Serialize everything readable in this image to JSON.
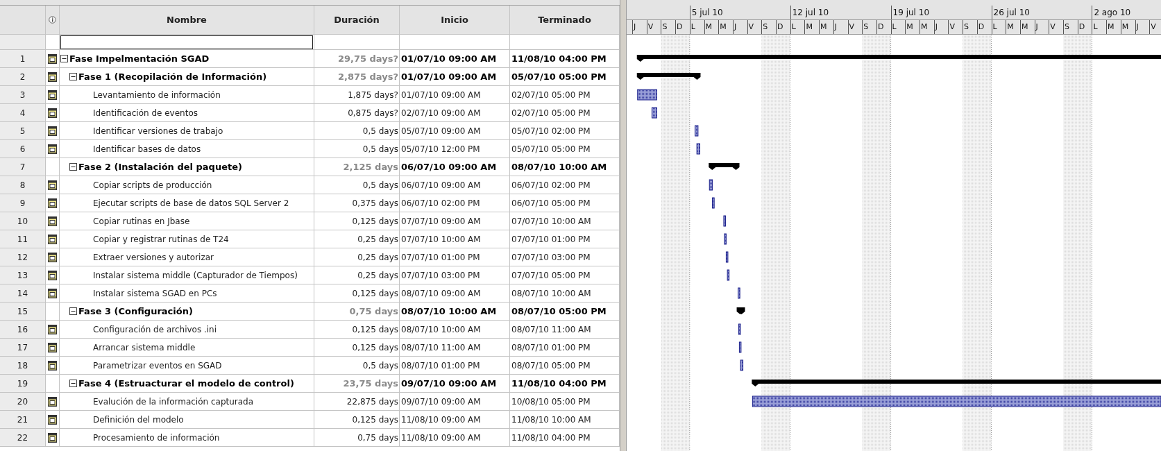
{
  "table": {
    "columns": [
      "Nombre",
      "Duración",
      "Inicio",
      "Terminado"
    ],
    "tasks": [
      {
        "id": "1",
        "kind": "summary",
        "name": "Fase Impelmentación SGAD",
        "duration": "29,75 days?",
        "start": "01/07/10 09:00 AM",
        "finish": "11/08/10 04:00 PM",
        "indicator": true,
        "expanded": true,
        "children": [
          {
            "id": "2",
            "kind": "summary",
            "name": "Fase 1 (Recopilación de Información)",
            "duration": "2,875 days?",
            "start": "01/07/10 09:00 AM",
            "finish": "05/07/10 05:00 PM",
            "indicator": true,
            "expanded": true,
            "children": [
              {
                "id": "3",
                "kind": "task",
                "name": "Levantamiento de información",
                "duration": "1,875 days?",
                "start": "01/07/10 09:00 AM",
                "finish": "02/07/10 05:00 PM",
                "indicator": true
              },
              {
                "id": "4",
                "kind": "task",
                "name": "Identificación de eventos",
                "duration": "0,875 days?",
                "start": "02/07/10 09:00 AM",
                "finish": "02/07/10 05:00 PM",
                "indicator": true
              },
              {
                "id": "5",
                "kind": "task",
                "name": "Identificar versiones de trabajo",
                "duration": "0,5 days",
                "start": "05/07/10 09:00 AM",
                "finish": "05/07/10 02:00 PM",
                "indicator": true
              },
              {
                "id": "6",
                "kind": "task",
                "name": "Identificar bases de datos",
                "duration": "0,5 days",
                "start": "05/07/10 12:00 PM",
                "finish": "05/07/10 05:00 PM",
                "indicator": true
              }
            ]
          },
          {
            "id": "7",
            "kind": "summary",
            "name": "Fase 2 (Instalación del paquete)",
            "duration": "2,125 days",
            "start": "06/07/10 09:00 AM",
            "finish": "08/07/10 10:00 AM",
            "indicator": false,
            "expanded": true,
            "children": [
              {
                "id": "8",
                "kind": "task",
                "name": "Copiar scripts de producción",
                "duration": "0,5 days",
                "start": "06/07/10 09:00 AM",
                "finish": "06/07/10 02:00 PM",
                "indicator": true
              },
              {
                "id": "9",
                "kind": "task",
                "name": "Ejecutar scripts de base de datos SQL Server 2",
                "duration": "0,375 days",
                "start": "06/07/10 02:00 PM",
                "finish": "06/07/10 05:00 PM",
                "indicator": true
              },
              {
                "id": "10",
                "kind": "task",
                "name": "Copiar rutinas en Jbase",
                "duration": "0,125 days",
                "start": "07/07/10 09:00 AM",
                "finish": "07/07/10 10:00 AM",
                "indicator": true
              },
              {
                "id": "11",
                "kind": "task",
                "name": "Copiar y registrar rutinas de T24",
                "duration": "0,25 days",
                "start": "07/07/10 10:00 AM",
                "finish": "07/07/10 01:00 PM",
                "indicator": true
              },
              {
                "id": "12",
                "kind": "task",
                "name": "Extraer versiones y autorizar",
                "duration": "0,25 days",
                "start": "07/07/10 01:00 PM",
                "finish": "07/07/10 03:00 PM",
                "indicator": true
              },
              {
                "id": "13",
                "kind": "task",
                "name": "Instalar sistema middle (Capturador de Tiempos)",
                "duration": "0,25 days",
                "start": "07/07/10 03:00 PM",
                "finish": "07/07/10 05:00 PM",
                "indicator": true
              },
              {
                "id": "14",
                "kind": "task",
                "name": "Instalar sistema SGAD en PCs",
                "duration": "0,125 days",
                "start": "08/07/10 09:00 AM",
                "finish": "08/07/10 10:00 AM",
                "indicator": true
              }
            ]
          },
          {
            "id": "15",
            "kind": "summary",
            "name": "Fase 3 (Configuración)",
            "duration": "0,75 days",
            "start": "08/07/10 10:00 AM",
            "finish": "08/07/10 05:00 PM",
            "indicator": false,
            "expanded": true,
            "children": [
              {
                "id": "16",
                "kind": "task",
                "name": "Configuración de archivos .ini",
                "duration": "0,125 days",
                "start": "08/07/10 10:00 AM",
                "finish": "08/07/10 11:00 AM",
                "indicator": true
              },
              {
                "id": "17",
                "kind": "task",
                "name": "Arrancar sistema middle",
                "duration": "0,125 days",
                "start": "08/07/10 11:00 AM",
                "finish": "08/07/10 01:00 PM",
                "indicator": true
              },
              {
                "id": "18",
                "kind": "task",
                "name": "Parametrizar eventos en SGAD",
                "duration": "0,5 days",
                "start": "08/07/10 01:00 PM",
                "finish": "08/07/10 05:00 PM",
                "indicator": true
              }
            ]
          },
          {
            "id": "19",
            "kind": "summary",
            "name": "Fase 4 (Estruacturar el modelo de control)",
            "duration": "23,75 days",
            "start": "09/07/10 09:00 AM",
            "finish": "11/08/10 04:00 PM",
            "indicator": false,
            "expanded": true,
            "children": [
              {
                "id": "20",
                "kind": "task",
                "name": "Evalución de la información capturada",
                "duration": "22,875 days",
                "start": "09/07/10 09:00 AM",
                "finish": "10/08/10 05:00 PM",
                "indicator": true
              },
              {
                "id": "21",
                "kind": "task",
                "name": "Definición del modelo",
                "duration": "0,125 days",
                "start": "11/08/10 09:00 AM",
                "finish": "11/08/10 10:00 AM",
                "indicator": true
              },
              {
                "id": "22",
                "kind": "task",
                "name": "Procesamiento de información",
                "duration": "0,75 days",
                "start": "11/08/10 09:00 AM",
                "finish": "11/08/10 04:00 PM",
                "indicator": true
              }
            ]
          }
        ]
      }
    ]
  },
  "timescale": {
    "weeks": [
      "5 jul 10",
      "12 jul 10",
      "19 jul 10",
      "26 jul 10",
      "2 ago 10"
    ],
    "days": [
      {
        "letter": "J",
        "nonworking": false
      },
      {
        "letter": "V",
        "nonworking": false
      },
      {
        "letter": "S",
        "nonworking": true
      },
      {
        "letter": "D",
        "nonworking": true
      },
      {
        "letter": "L",
        "nonworking": false
      },
      {
        "letter": "M",
        "nonworking": false
      },
      {
        "letter": "M",
        "nonworking": false
      },
      {
        "letter": "J",
        "nonworking": false
      },
      {
        "letter": "V",
        "nonworking": false
      },
      {
        "letter": "S",
        "nonworking": true
      },
      {
        "letter": "D",
        "nonworking": true
      },
      {
        "letter": "L",
        "nonworking": false
      },
      {
        "letter": "M",
        "nonworking": false
      },
      {
        "letter": "M",
        "nonworking": false
      },
      {
        "letter": "J",
        "nonworking": false
      },
      {
        "letter": "V",
        "nonworking": false
      },
      {
        "letter": "S",
        "nonworking": true
      },
      {
        "letter": "D",
        "nonworking": true
      },
      {
        "letter": "L",
        "nonworking": false
      },
      {
        "letter": "M",
        "nonworking": false
      },
      {
        "letter": "M",
        "nonworking": false
      },
      {
        "letter": "J",
        "nonworking": false
      },
      {
        "letter": "V",
        "nonworking": false
      },
      {
        "letter": "S",
        "nonworking": true
      },
      {
        "letter": "D",
        "nonworking": true
      },
      {
        "letter": "L",
        "nonworking": false
      },
      {
        "letter": "M",
        "nonworking": false
      },
      {
        "letter": "M",
        "nonworking": false
      },
      {
        "letter": "J",
        "nonworking": false
      },
      {
        "letter": "V",
        "nonworking": false
      },
      {
        "letter": "S",
        "nonworking": true
      },
      {
        "letter": "D",
        "nonworking": true
      },
      {
        "letter": "L",
        "nonworking": false
      },
      {
        "letter": "M",
        "nonworking": false
      },
      {
        "letter": "M",
        "nonworking": false
      },
      {
        "letter": "J",
        "nonworking": false
      },
      {
        "letter": "V",
        "nonworking": false
      }
    ]
  }
}
